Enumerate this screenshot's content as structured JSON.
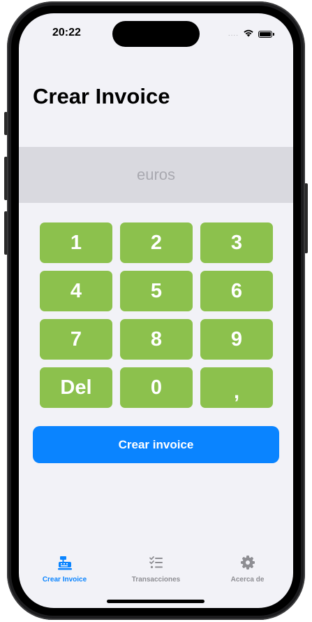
{
  "status_bar": {
    "time": "20:22",
    "signal": "....",
    "wifi_icon": "wifi-icon",
    "battery_icon": "battery-icon"
  },
  "header": {
    "title": "Crear Invoice"
  },
  "amount": {
    "value": "",
    "placeholder": "euros"
  },
  "keypad": {
    "keys": [
      "1",
      "2",
      "3",
      "4",
      "5",
      "6",
      "7",
      "8",
      "9",
      "Del",
      "0",
      ","
    ]
  },
  "actions": {
    "create_label": "Crear invoice"
  },
  "tab_bar": {
    "items": [
      {
        "label": "Crear Invoice",
        "icon": "cash-register-icon",
        "active": true
      },
      {
        "label": "Transacciones",
        "icon": "checklist-icon",
        "active": false
      },
      {
        "label": "Acerca de",
        "icon": "gear-icon",
        "active": false
      }
    ]
  },
  "colors": {
    "background": "#f2f2f7",
    "amount_area": "#d9d9df",
    "key": "#8cc14d",
    "primary": "#0a84ff",
    "tab_inactive": "#8e8e93"
  }
}
